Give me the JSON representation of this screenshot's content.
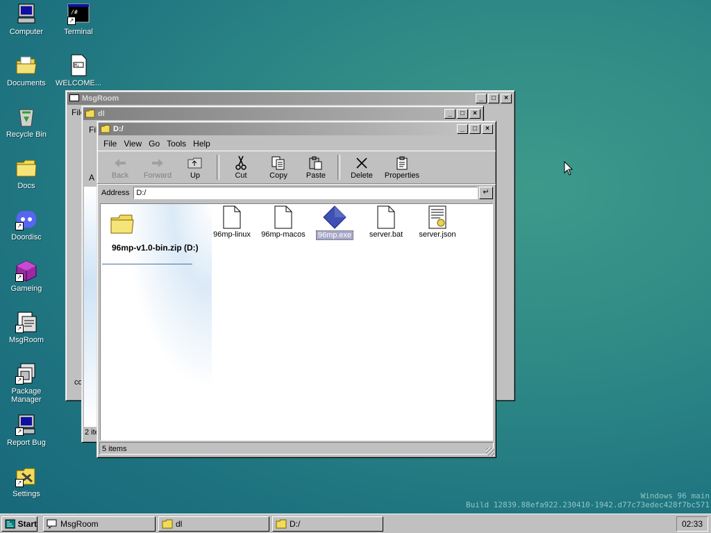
{
  "desktop": {
    "icons": [
      {
        "label": "Computer"
      },
      {
        "label": "Terminal"
      },
      {
        "label": "Documents"
      },
      {
        "label": "WELCOME..."
      },
      {
        "label": "Recycle Bin"
      },
      {
        "label": "Docs"
      },
      {
        "label": "Doordisc"
      },
      {
        "label": "Gameing"
      },
      {
        "label": "MsgRoom"
      },
      {
        "label": "Package Manager"
      },
      {
        "label": "Report Bug"
      },
      {
        "label": "Settings"
      }
    ],
    "watermark_line1": "Windows 96 main",
    "watermark_line2": "Build 12839.88efa922.230410-1942.d77c73edec428f7bc571"
  },
  "msgroom_window": {
    "title": "MsgRoom",
    "menu_fragment": "File",
    "footer_fragment": "co"
  },
  "dl_window": {
    "title": "dl",
    "menu_fragment": "Fil",
    "addr_fragment": "A",
    "status_fragment": "2 ite"
  },
  "explorer": {
    "title": "D:/",
    "menu": [
      "File",
      "View",
      "Go",
      "Tools",
      "Help"
    ],
    "toolbar": {
      "back": "Back",
      "forward": "Forward",
      "up": "Up",
      "cut": "Cut",
      "copy": "Copy",
      "paste": "Paste",
      "delete": "Delete",
      "properties": "Properties"
    },
    "address_label": "Address",
    "address_value": "D:/",
    "drive_label": "96mp-v1.0-bin.zip (D:)",
    "files": [
      {
        "name": "96mp-linux",
        "icon": "file-icon"
      },
      {
        "name": "96mp-macos",
        "icon": "file-icon"
      },
      {
        "name": "96mp.exe",
        "icon": "exe-icon",
        "selected": true
      },
      {
        "name": "server.bat",
        "icon": "file-icon"
      },
      {
        "name": "server.json",
        "icon": "json-file-icon"
      }
    ],
    "status": "5 items"
  },
  "taskbar": {
    "start": "Start",
    "tasks": [
      "MsgRoom",
      "dl",
      "D:/"
    ],
    "clock": "02:33"
  },
  "colors": {
    "desktop": "#1f7480",
    "window": "#c0c0c0"
  }
}
